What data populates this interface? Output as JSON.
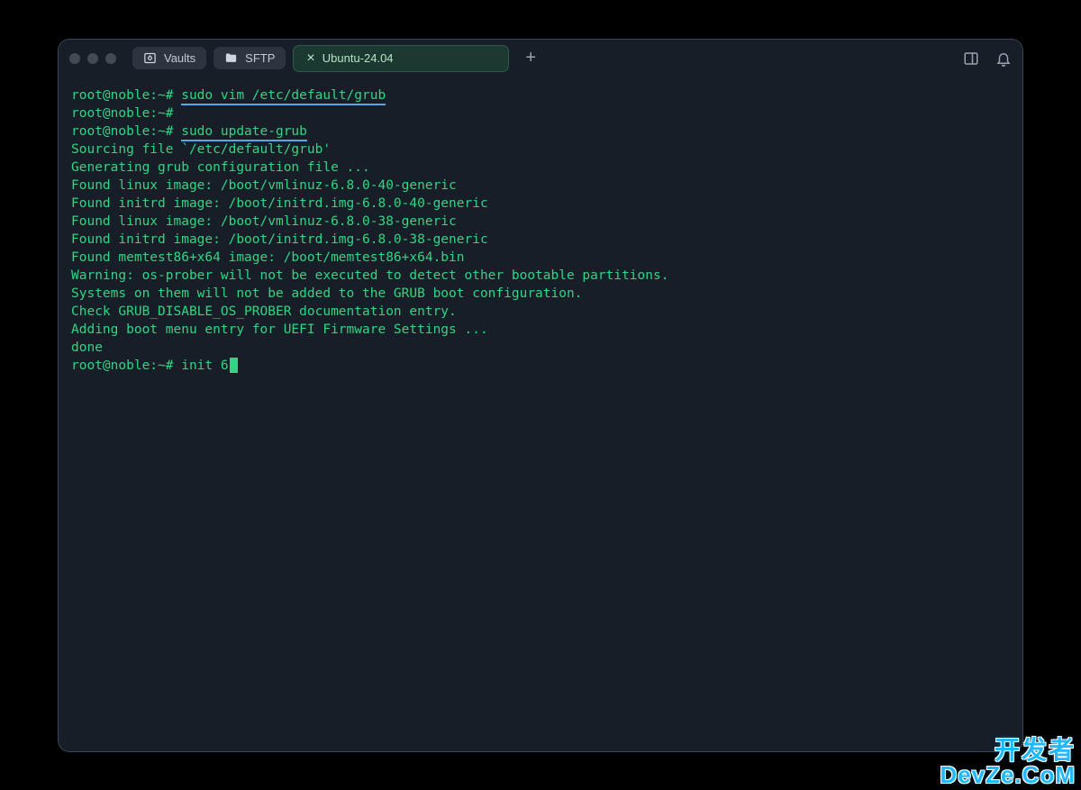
{
  "window": {
    "traffic_lights": 3,
    "pills": {
      "vaults": {
        "label": "Vaults",
        "icon": "vault-icon"
      },
      "sftp": {
        "label": "SFTP",
        "icon": "folder-icon"
      }
    },
    "active_tab": {
      "label": "Ubuntu-24.04",
      "close_glyph": "×"
    },
    "add_tab_glyph": "+"
  },
  "colors": {
    "background": "#171e28",
    "text_green": "#32d583",
    "underline_blue": "#5aa7e6",
    "tab_active_bg": "#1b3931"
  },
  "terminal": {
    "prompt": "root@noble:~# ",
    "lines": [
      {
        "type": "prompt_cmd",
        "cmd": "sudo vim /etc/default/grub",
        "hl": true
      },
      {
        "type": "prompt",
        "text": ""
      },
      {
        "type": "prompt_cmd",
        "cmd": "sudo update-grub",
        "hl": true
      },
      {
        "type": "out",
        "text": "Sourcing file `/etc/default/grub'"
      },
      {
        "type": "out",
        "text": "Generating grub configuration file ..."
      },
      {
        "type": "out",
        "text": "Found linux image: /boot/vmlinuz-6.8.0-40-generic"
      },
      {
        "type": "out",
        "text": "Found initrd image: /boot/initrd.img-6.8.0-40-generic"
      },
      {
        "type": "out",
        "text": "Found linux image: /boot/vmlinuz-6.8.0-38-generic"
      },
      {
        "type": "out",
        "text": "Found initrd image: /boot/initrd.img-6.8.0-38-generic"
      },
      {
        "type": "out",
        "text": "Found memtest86+x64 image: /boot/memtest86+x64.bin"
      },
      {
        "type": "out",
        "text": "Warning: os-prober will not be executed to detect other bootable partitions."
      },
      {
        "type": "out",
        "text": "Systems on them will not be added to the GRUB boot configuration."
      },
      {
        "type": "out",
        "text": "Check GRUB_DISABLE_OS_PROBER documentation entry."
      },
      {
        "type": "out",
        "text": "Adding boot menu entry for UEFI Firmware Settings ..."
      },
      {
        "type": "out",
        "text": "done"
      },
      {
        "type": "prompt_cursor",
        "cmd": "init 6"
      }
    ]
  },
  "watermark": {
    "line1": "开发者",
    "line2": "DevZe.CoM"
  }
}
